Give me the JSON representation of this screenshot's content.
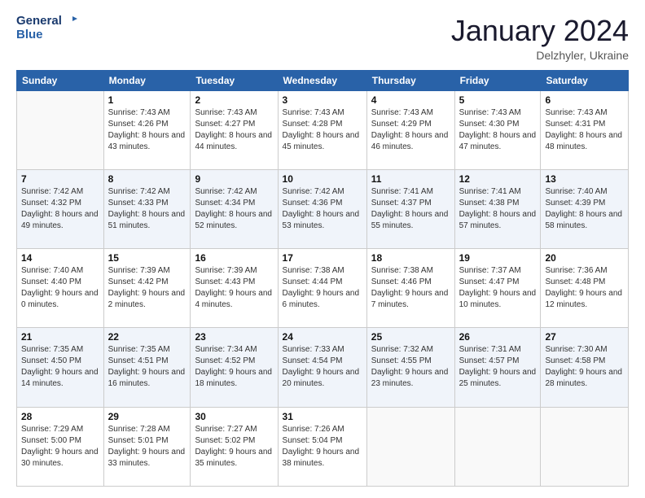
{
  "header": {
    "logo_line1": "General",
    "logo_line2": "Blue",
    "month": "January 2024",
    "location": "Delzhyler, Ukraine"
  },
  "days": [
    "Sunday",
    "Monday",
    "Tuesday",
    "Wednesday",
    "Thursday",
    "Friday",
    "Saturday"
  ],
  "weeks": [
    [
      {
        "num": "",
        "sunrise": "",
        "sunset": "",
        "daylight": "",
        "empty": true
      },
      {
        "num": "1",
        "sunrise": "Sunrise: 7:43 AM",
        "sunset": "Sunset: 4:26 PM",
        "daylight": "Daylight: 8 hours and 43 minutes."
      },
      {
        "num": "2",
        "sunrise": "Sunrise: 7:43 AM",
        "sunset": "Sunset: 4:27 PM",
        "daylight": "Daylight: 8 hours and 44 minutes."
      },
      {
        "num": "3",
        "sunrise": "Sunrise: 7:43 AM",
        "sunset": "Sunset: 4:28 PM",
        "daylight": "Daylight: 8 hours and 45 minutes."
      },
      {
        "num": "4",
        "sunrise": "Sunrise: 7:43 AM",
        "sunset": "Sunset: 4:29 PM",
        "daylight": "Daylight: 8 hours and 46 minutes."
      },
      {
        "num": "5",
        "sunrise": "Sunrise: 7:43 AM",
        "sunset": "Sunset: 4:30 PM",
        "daylight": "Daylight: 8 hours and 47 minutes."
      },
      {
        "num": "6",
        "sunrise": "Sunrise: 7:43 AM",
        "sunset": "Sunset: 4:31 PM",
        "daylight": "Daylight: 8 hours and 48 minutes."
      }
    ],
    [
      {
        "num": "7",
        "sunrise": "Sunrise: 7:42 AM",
        "sunset": "Sunset: 4:32 PM",
        "daylight": "Daylight: 8 hours and 49 minutes."
      },
      {
        "num": "8",
        "sunrise": "Sunrise: 7:42 AM",
        "sunset": "Sunset: 4:33 PM",
        "daylight": "Daylight: 8 hours and 51 minutes."
      },
      {
        "num": "9",
        "sunrise": "Sunrise: 7:42 AM",
        "sunset": "Sunset: 4:34 PM",
        "daylight": "Daylight: 8 hours and 52 minutes."
      },
      {
        "num": "10",
        "sunrise": "Sunrise: 7:42 AM",
        "sunset": "Sunset: 4:36 PM",
        "daylight": "Daylight: 8 hours and 53 minutes."
      },
      {
        "num": "11",
        "sunrise": "Sunrise: 7:41 AM",
        "sunset": "Sunset: 4:37 PM",
        "daylight": "Daylight: 8 hours and 55 minutes."
      },
      {
        "num": "12",
        "sunrise": "Sunrise: 7:41 AM",
        "sunset": "Sunset: 4:38 PM",
        "daylight": "Daylight: 8 hours and 57 minutes."
      },
      {
        "num": "13",
        "sunrise": "Sunrise: 7:40 AM",
        "sunset": "Sunset: 4:39 PM",
        "daylight": "Daylight: 8 hours and 58 minutes."
      }
    ],
    [
      {
        "num": "14",
        "sunrise": "Sunrise: 7:40 AM",
        "sunset": "Sunset: 4:40 PM",
        "daylight": "Daylight: 9 hours and 0 minutes."
      },
      {
        "num": "15",
        "sunrise": "Sunrise: 7:39 AM",
        "sunset": "Sunset: 4:42 PM",
        "daylight": "Daylight: 9 hours and 2 minutes."
      },
      {
        "num": "16",
        "sunrise": "Sunrise: 7:39 AM",
        "sunset": "Sunset: 4:43 PM",
        "daylight": "Daylight: 9 hours and 4 minutes."
      },
      {
        "num": "17",
        "sunrise": "Sunrise: 7:38 AM",
        "sunset": "Sunset: 4:44 PM",
        "daylight": "Daylight: 9 hours and 6 minutes."
      },
      {
        "num": "18",
        "sunrise": "Sunrise: 7:38 AM",
        "sunset": "Sunset: 4:46 PM",
        "daylight": "Daylight: 9 hours and 7 minutes."
      },
      {
        "num": "19",
        "sunrise": "Sunrise: 7:37 AM",
        "sunset": "Sunset: 4:47 PM",
        "daylight": "Daylight: 9 hours and 10 minutes."
      },
      {
        "num": "20",
        "sunrise": "Sunrise: 7:36 AM",
        "sunset": "Sunset: 4:48 PM",
        "daylight": "Daylight: 9 hours and 12 minutes."
      }
    ],
    [
      {
        "num": "21",
        "sunrise": "Sunrise: 7:35 AM",
        "sunset": "Sunset: 4:50 PM",
        "daylight": "Daylight: 9 hours and 14 minutes."
      },
      {
        "num": "22",
        "sunrise": "Sunrise: 7:35 AM",
        "sunset": "Sunset: 4:51 PM",
        "daylight": "Daylight: 9 hours and 16 minutes."
      },
      {
        "num": "23",
        "sunrise": "Sunrise: 7:34 AM",
        "sunset": "Sunset: 4:52 PM",
        "daylight": "Daylight: 9 hours and 18 minutes."
      },
      {
        "num": "24",
        "sunrise": "Sunrise: 7:33 AM",
        "sunset": "Sunset: 4:54 PM",
        "daylight": "Daylight: 9 hours and 20 minutes."
      },
      {
        "num": "25",
        "sunrise": "Sunrise: 7:32 AM",
        "sunset": "Sunset: 4:55 PM",
        "daylight": "Daylight: 9 hours and 23 minutes."
      },
      {
        "num": "26",
        "sunrise": "Sunrise: 7:31 AM",
        "sunset": "Sunset: 4:57 PM",
        "daylight": "Daylight: 9 hours and 25 minutes."
      },
      {
        "num": "27",
        "sunrise": "Sunrise: 7:30 AM",
        "sunset": "Sunset: 4:58 PM",
        "daylight": "Daylight: 9 hours and 28 minutes."
      }
    ],
    [
      {
        "num": "28",
        "sunrise": "Sunrise: 7:29 AM",
        "sunset": "Sunset: 5:00 PM",
        "daylight": "Daylight: 9 hours and 30 minutes."
      },
      {
        "num": "29",
        "sunrise": "Sunrise: 7:28 AM",
        "sunset": "Sunset: 5:01 PM",
        "daylight": "Daylight: 9 hours and 33 minutes."
      },
      {
        "num": "30",
        "sunrise": "Sunrise: 7:27 AM",
        "sunset": "Sunset: 5:02 PM",
        "daylight": "Daylight: 9 hours and 35 minutes."
      },
      {
        "num": "31",
        "sunrise": "Sunrise: 7:26 AM",
        "sunset": "Sunset: 5:04 PM",
        "daylight": "Daylight: 9 hours and 38 minutes."
      },
      {
        "num": "",
        "sunrise": "",
        "sunset": "",
        "daylight": "",
        "empty": true
      },
      {
        "num": "",
        "sunrise": "",
        "sunset": "",
        "daylight": "",
        "empty": true
      },
      {
        "num": "",
        "sunrise": "",
        "sunset": "",
        "daylight": "",
        "empty": true
      }
    ]
  ]
}
